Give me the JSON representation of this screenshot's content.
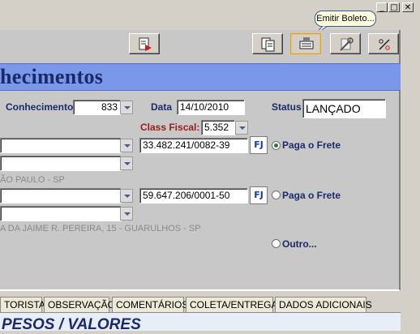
{
  "window_controls": {
    "minimize": "_",
    "maximize": "□",
    "close": "✕"
  },
  "tooltip": "Emitir Boleto...",
  "toolbar": {
    "buttons": [
      {
        "icon": "page-arrow-icon"
      },
      {
        "icon": "copy-pages-icon"
      },
      {
        "icon": "boleto-icon"
      },
      {
        "icon": "wrench-tool-icon"
      },
      {
        "icon": "percent-icon"
      }
    ]
  },
  "banner": {
    "title": "hecimentos"
  },
  "form": {
    "conhecimento_label": "Conhecimento",
    "conhecimento_value": "833",
    "data_label": "Data",
    "data_value": "14/10/2010",
    "status_label": "Status",
    "status_value": "LANÇADO",
    "class_fiscal_label": "Class Fiscal:",
    "class_fiscal_value": "5.352",
    "remetente_cnpj": "33.482.241/0082-39",
    "remetente_city": "ÃO PAULO - SP",
    "destinatario_cnpj": "59.647.206/0001-50",
    "destinatario_address": "A DA JAIME R. PEREIRA, 15 - GUARULHOS - SP",
    "fj_label": "FJ",
    "paga_frete_1": "Paga o Frete",
    "paga_frete_2": "Paga o Frete",
    "outro": "Outro..."
  },
  "tabs": [
    "TORISTA",
    "OBSERVAÇÃO",
    "COMENTÁRIOS",
    "COLETA/ENTREGA",
    "DADOS ADICIONAIS"
  ],
  "section_title": "PESOS / VALORES"
}
